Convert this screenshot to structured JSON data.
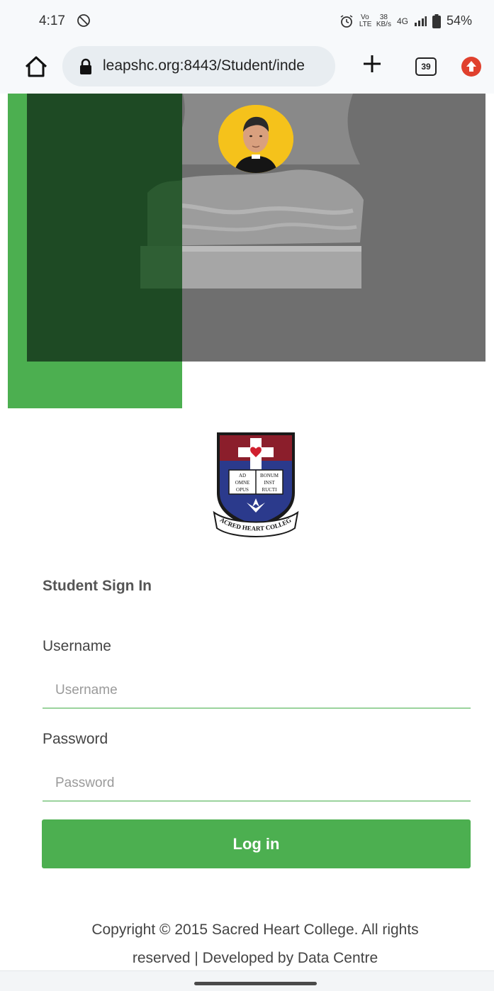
{
  "status_bar": {
    "time": "4:17",
    "volte": "Vo LTE",
    "network_speed_value": "38",
    "network_speed_unit": "KB/s",
    "network": "4G",
    "battery": "54%"
  },
  "browser": {
    "url": "leapshc.org:8443/Student/inde",
    "tab_count": "39"
  },
  "logo": {
    "motto_left_1": "AD",
    "motto_left_2": "OMNE",
    "motto_left_3": "OPUS",
    "motto_right_1": "BONUM",
    "motto_right_2": "INST",
    "motto_right_3": "RUCTI",
    "banner_text": "SACRED HEART COLLEGE"
  },
  "form": {
    "title": "Student Sign In",
    "username_label": "Username",
    "username_placeholder": "Username",
    "username_value": "",
    "password_label": "Password",
    "password_placeholder": "Password",
    "password_value": "",
    "login_label": "Log in"
  },
  "footer": {
    "line1": "Copyright © 2015 Sacred Heart College. All rights",
    "line2": "reserved | Developed by Data Centre"
  },
  "colors": {
    "accent_green": "#4caf50",
    "dark_green": "#1e4a24",
    "shield_maroon": "#8b1e2b",
    "shield_navy": "#2b3a8c"
  }
}
